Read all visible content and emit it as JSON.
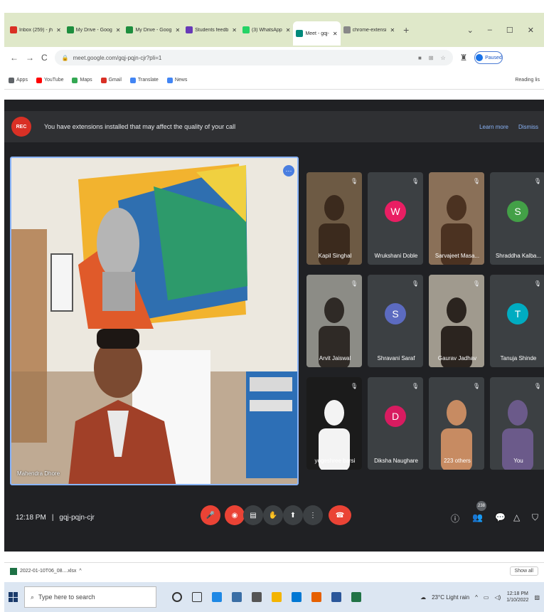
{
  "browser": {
    "tabs": [
      {
        "label": "Inbox (259) - jh",
        "color": "#d93025",
        "active": false
      },
      {
        "label": "My Drive - Goog",
        "color": "#1e8e3e",
        "active": false
      },
      {
        "label": "My Drive - Goog",
        "color": "#1e8e3e",
        "active": false
      },
      {
        "label": "Students feedb",
        "color": "#673ab7",
        "active": false
      },
      {
        "label": "(3) WhatsApp",
        "color": "#25d366",
        "active": false
      },
      {
        "label": "Meet - gqj-",
        "color": "#00897b",
        "active": true
      },
      {
        "label": "chrome-extensi",
        "color": "#888888",
        "active": false
      }
    ],
    "new_tab": "+",
    "window_controls": [
      "⌄",
      "–",
      "☐",
      "✕"
    ],
    "url": "meet.google.com/gqj-pqjn-cjr?pli=1",
    "profile_label": "Paused",
    "bookmarks": [
      {
        "label": "Apps",
        "color": "#5f6368"
      },
      {
        "label": "YouTube",
        "color": "#ff0000"
      },
      {
        "label": "Maps",
        "color": "#34a853"
      },
      {
        "label": "Gmail",
        "color": "#d93025"
      },
      {
        "label": "Translate",
        "color": "#4285f4"
      },
      {
        "label": "News",
        "color": "#4285f4"
      }
    ],
    "reading_list": "Reading lis"
  },
  "meet": {
    "rec_label": "REC",
    "banner_text": "You have extensions installed that may affect the quality of your call",
    "learn_more": "Learn more",
    "dismiss": "Dismiss",
    "main_speaker": "Mahendra Dhore",
    "participants": [
      {
        "name": "Kapil Singhal",
        "initial": "",
        "color": ""
      },
      {
        "name": "Wrukshani Doble",
        "initial": "W",
        "color": "#e91e63"
      },
      {
        "name": "Sarvajeet Masa...",
        "initial": "",
        "color": ""
      },
      {
        "name": "Shraddha Kalba...",
        "initial": "S",
        "color": "#43a047"
      },
      {
        "name": "Arvit Jaiswal",
        "initial": "",
        "color": ""
      },
      {
        "name": "Shravani Saraf",
        "initial": "S",
        "color": "#5c6bc0"
      },
      {
        "name": "Gaurav Jadhav",
        "initial": "",
        "color": ""
      },
      {
        "name": "Tanuja Shinde",
        "initial": "T",
        "color": "#00acc1"
      },
      {
        "name": "yogeshree barsi",
        "initial": "",
        "color": ""
      },
      {
        "name": "Diksha Naughare",
        "initial": "D",
        "color": "#d81b60"
      },
      {
        "name": "223 others",
        "initial": "",
        "color": ""
      },
      {
        "name": "You",
        "initial": "",
        "color": ""
      }
    ],
    "time": "12:18 PM",
    "meeting_code": "gqj-pqjn-cjr",
    "participant_count": "238"
  },
  "downloads": {
    "file": "2022-01-10T06_08....xlsx",
    "show_all": "Show all"
  },
  "taskbar": {
    "search_placeholder": "Type here to search",
    "weather": "23°C  Light rain",
    "clock_time": "12:18 PM",
    "clock_date": "1/10/2022"
  }
}
